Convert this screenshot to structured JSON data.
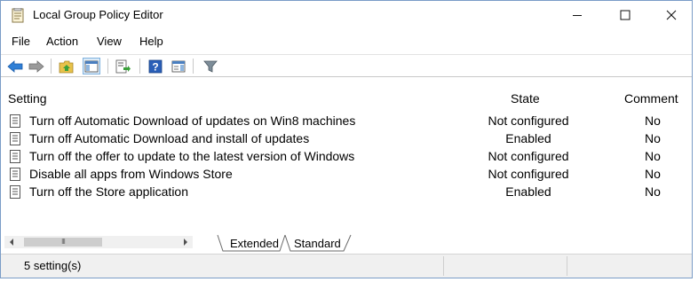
{
  "window": {
    "title": "Local Group Policy Editor"
  },
  "menu": {
    "items": [
      "File",
      "Action",
      "View",
      "Help"
    ]
  },
  "toolbar": {
    "buttons": [
      "back-arrow-icon",
      "forward-arrow-icon",
      "up-folder-icon",
      "show-hide-tree-icon",
      "export-list-icon",
      "help-icon",
      "show-hide-action-pane-icon",
      "filter-icon"
    ]
  },
  "list": {
    "headers": {
      "setting": "Setting",
      "state": "State",
      "comment": "Comment"
    },
    "rows": [
      {
        "setting": "Turn off Automatic Download of updates on Win8 machines",
        "state": "Not configured",
        "comment": "No"
      },
      {
        "setting": "Turn off Automatic Download and install of updates",
        "state": "Enabled",
        "comment": "No"
      },
      {
        "setting": "Turn off the offer to update to the latest version of Windows",
        "state": "Not configured",
        "comment": "No"
      },
      {
        "setting": "Disable all apps from Windows Store",
        "state": "Not configured",
        "comment": "No"
      },
      {
        "setting": "Turn off the Store application",
        "state": "Enabled",
        "comment": "No"
      }
    ]
  },
  "scrollbar": {
    "thumb_glyph": "III"
  },
  "tabs": {
    "extended": "Extended",
    "standard": "Standard",
    "active": "Extended"
  },
  "status": {
    "text": "5 setting(s)"
  },
  "colors": {
    "accent": "#1e6fc8",
    "title_text": "#000000",
    "tab_active_bg": "#ffffff"
  }
}
